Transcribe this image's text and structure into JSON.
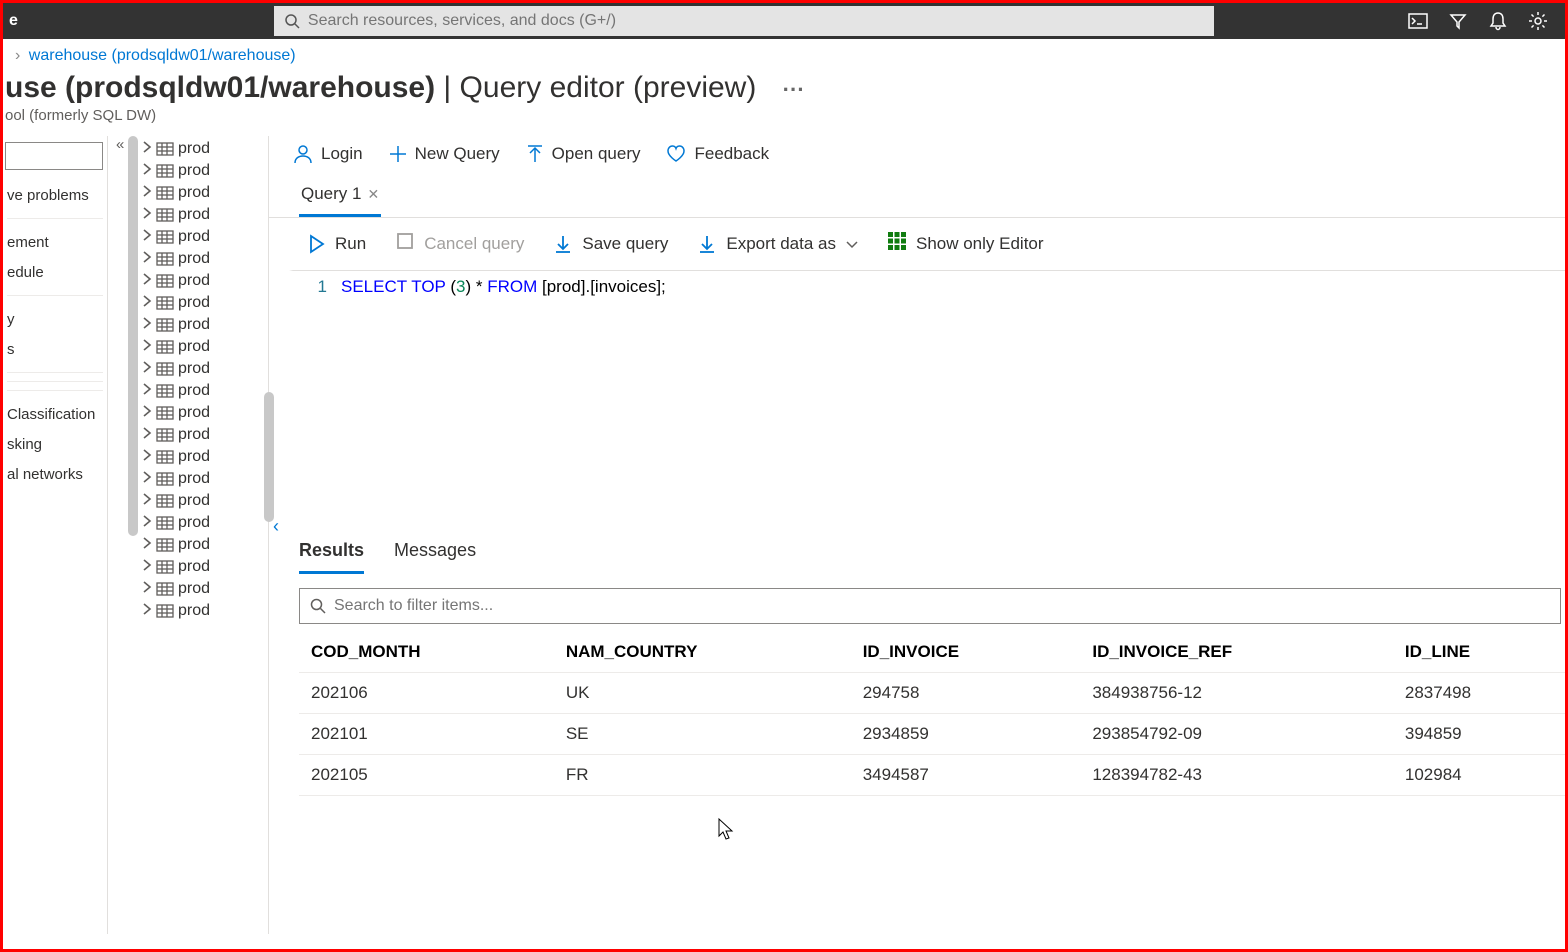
{
  "topbar": {
    "left_label": "e",
    "search_placeholder": "Search resources, services, and docs (G+/)"
  },
  "breadcrumb": {
    "link": "warehouse (prodsqldw01/warehouse)"
  },
  "heading": {
    "title_bold": "use (prodsqldw01/warehouse)",
    "title_light": " | Query editor (preview)",
    "subtitle": "ool (formerly SQL DW)"
  },
  "left_nav": {
    "items": [
      "ve problems",
      "",
      "ement",
      "edule",
      "",
      "y",
      "s",
      "",
      "",
      "",
      "Classification",
      "sking",
      "al networks"
    ]
  },
  "tree": {
    "node_label": "prod",
    "count": 22
  },
  "cmdbar": {
    "login": "Login",
    "new_query": "New Query",
    "open_query": "Open query",
    "feedback": "Feedback"
  },
  "tabs": {
    "query1": "Query 1"
  },
  "toolbar": {
    "run": "Run",
    "cancel": "Cancel query",
    "save": "Save query",
    "export": "Export data as",
    "editor_only": "Show only Editor"
  },
  "editor": {
    "line_no": "1",
    "kw_select": "SELECT",
    "kw_top": "TOP",
    "paren_open": "(",
    "num_3": "3",
    "paren_close": ")",
    "star": " * ",
    "kw_from": "FROM",
    "rest": " [prod].[invoices];"
  },
  "results": {
    "tab_results": "Results",
    "tab_messages": "Messages",
    "filter_placeholder": "Search to filter items...",
    "columns": [
      "COD_MONTH",
      "NAM_COUNTRY",
      "ID_INVOICE",
      "ID_INVOICE_REF",
      "ID_LINE"
    ],
    "rows": [
      [
        "202106",
        "UK",
        "294758",
        "384938756-12",
        "2837498"
      ],
      [
        "202101",
        "SE",
        "2934859",
        "293854792-09",
        "394859"
      ],
      [
        "202105",
        "FR",
        "3494587",
        "128394782-43",
        "102984"
      ]
    ]
  }
}
